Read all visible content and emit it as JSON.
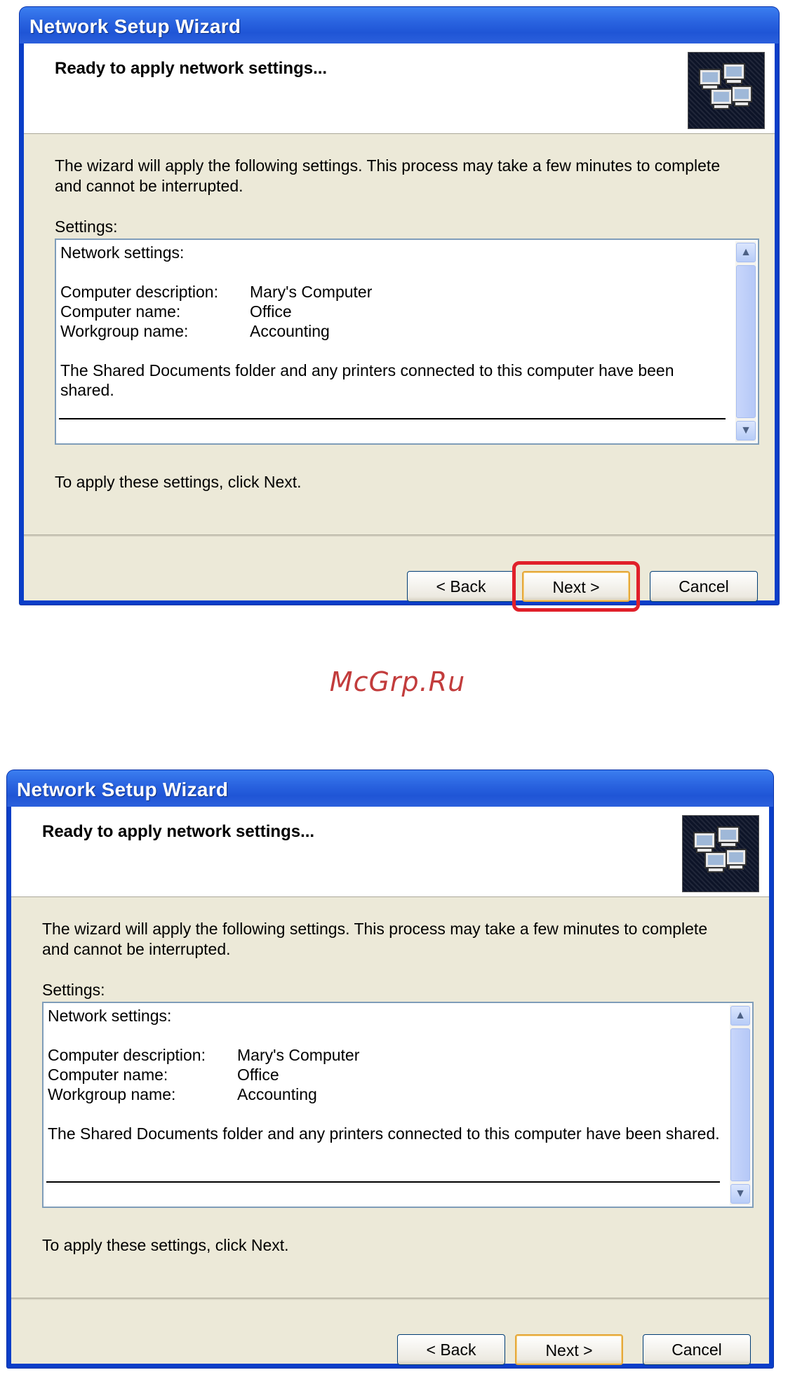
{
  "dialogs": [
    {
      "title": "Network Setup Wizard",
      "heading": "Ready to apply network settings...",
      "intro": "The wizard will apply the following settings. This process may take a few minutes to complete and cannot be interrupted.",
      "settings_label": "Settings:",
      "list": {
        "section": "Network settings:",
        "rows": [
          {
            "key": "Computer description:",
            "value": "Mary's Computer"
          },
          {
            "key": "Computer name:",
            "value": "Office"
          },
          {
            "key": "Workgroup name:",
            "value": "Accounting"
          }
        ],
        "note": "The Shared Documents folder and any printers connected to this computer have been shared."
      },
      "apply_note": "To apply these settings, click Next.",
      "buttons": {
        "back": "< Back",
        "next": "Next >",
        "cancel": "Cancel"
      },
      "next_highlighted": true
    },
    {
      "title": "Network Setup Wizard",
      "heading": "Ready to apply network settings...",
      "intro": "The wizard will apply the following settings. This process may take a few minutes to complete and cannot be interrupted.",
      "settings_label": "Settings:",
      "list": {
        "section": "Network settings:",
        "rows": [
          {
            "key": "Computer description:",
            "value": "Mary's Computer"
          },
          {
            "key": "Computer name:",
            "value": "Office"
          },
          {
            "key": "Workgroup name:",
            "value": "Accounting"
          }
        ],
        "note": "The Shared Documents folder and any printers connected to this computer have been shared."
      },
      "apply_note": "To apply these settings, click Next.",
      "buttons": {
        "back": "< Back",
        "next": "Next >",
        "cancel": "Cancel"
      },
      "next_highlighted": false
    }
  ],
  "watermark": "McGrp.Ru",
  "colors": {
    "titlebar": "#2a64e0",
    "client": "#ece9d8",
    "highlight": "#e0202a",
    "watermark": "#c23c3c"
  }
}
